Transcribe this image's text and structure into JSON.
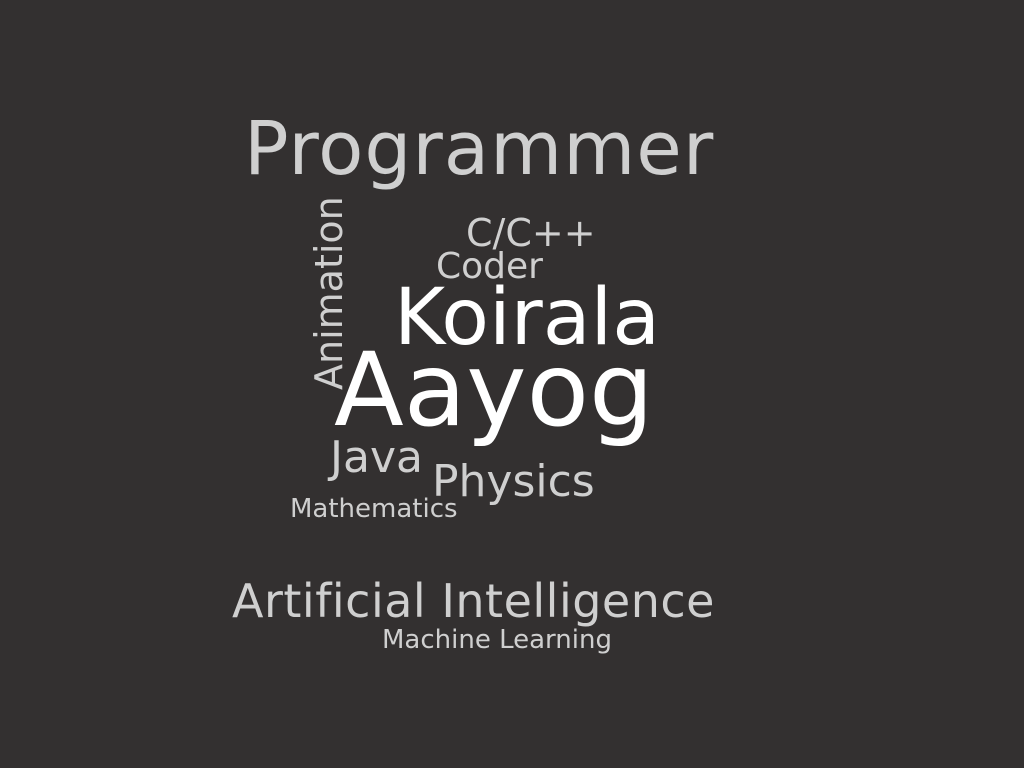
{
  "background_color": "#333030",
  "colors": {
    "light_text": "#cfcfcf",
    "bright_text": "#ffffff"
  },
  "words": {
    "programmer": "Programmer",
    "cpp": "C/C++",
    "coder": "Coder",
    "animation": "Animation",
    "koirala": "Koirala",
    "aayog": "Aayog",
    "java": "Java",
    "physics": "Physics",
    "mathematics": "Mathematics",
    "artificial_intelligence": "Artificial Intelligence",
    "machine_learning": "Machine Learning"
  }
}
